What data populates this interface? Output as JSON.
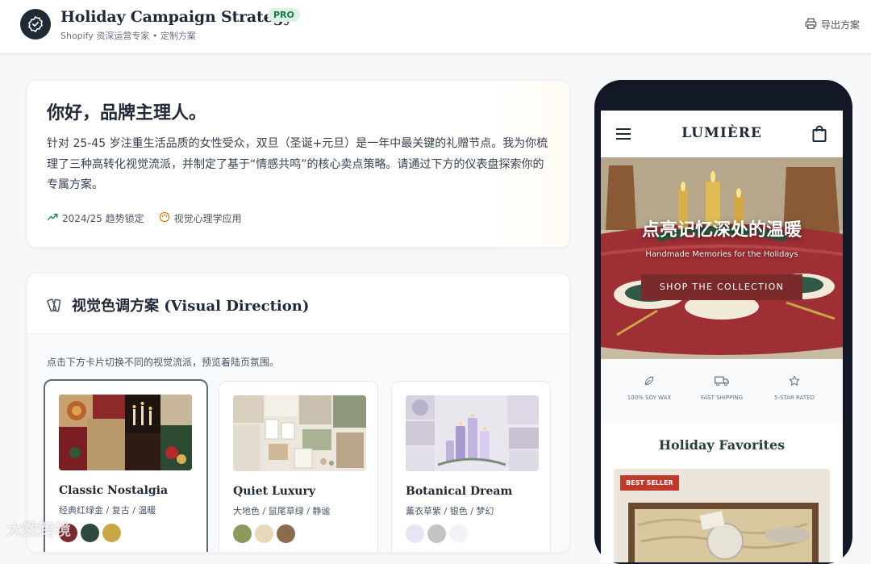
{
  "header": {
    "title": "Holiday Campaign Strategy",
    "badge": "PRO",
    "subtitle": "Shopify 资深运营专家 • 定制方案",
    "export_label": "导出方案"
  },
  "intro": {
    "greeting": "你好，品牌主理人。",
    "body": "针对 25-45 岁注重生活品质的女性受众，双旦（圣诞+元旦）是一年中最关键的礼赠节点。我为你梳理了三种高转化视觉流派，并制定了基于“情感共鸣”的核心卖点策略。请通过下方的仪表盘探索你的专属方案。",
    "tags": [
      {
        "icon": "trending-up-icon",
        "label": "2024/25 趋势锁定"
      },
      {
        "icon": "palette-icon",
        "label": "视觉心理学应用"
      }
    ]
  },
  "visual_direction": {
    "title": "视觉色调方案 (Visual Direction)",
    "hint": "点击下方卡片切换不同的视觉流派，预览着陆页氛围。",
    "cards": [
      {
        "name": "Classic Nostalgia",
        "desc": "经典红绿金 / 复古 / 温暖",
        "swatches": [
          "#7a2a32",
          "#2c4a3e",
          "#c9a646"
        ],
        "active": true
      },
      {
        "name": "Quiet Luxury",
        "desc": "大地色 / 鼠尾草绿 / 静谧",
        "swatches": [
          "#8a9a5b",
          "#e6d8b8",
          "#8b6b4a"
        ],
        "active": false
      },
      {
        "name": "Botanical Dream",
        "desc": "薰衣草紫 / 银色 / 梦幻",
        "swatches": [
          "#e6e4f5",
          "#c4c4c4",
          "#f3f2f8"
        ],
        "active": false
      }
    ]
  },
  "phone": {
    "brand": "LUMIÈRE",
    "hero_title": "点亮记忆深处的温暖",
    "hero_subtitle": "Handmade Memories for the Holidays",
    "hero_button": "SHOP THE COLLECTION",
    "features": [
      {
        "icon": "leaf-icon",
        "label": "100% SOY WAX"
      },
      {
        "icon": "truck-icon",
        "label": "FAST SHIPPING"
      },
      {
        "icon": "star-icon",
        "label": "5-STAR RATED"
      }
    ],
    "favorites_title": "Holiday Favorites",
    "product_badge": "BEST SELLER"
  },
  "watermark": "大数跨境"
}
